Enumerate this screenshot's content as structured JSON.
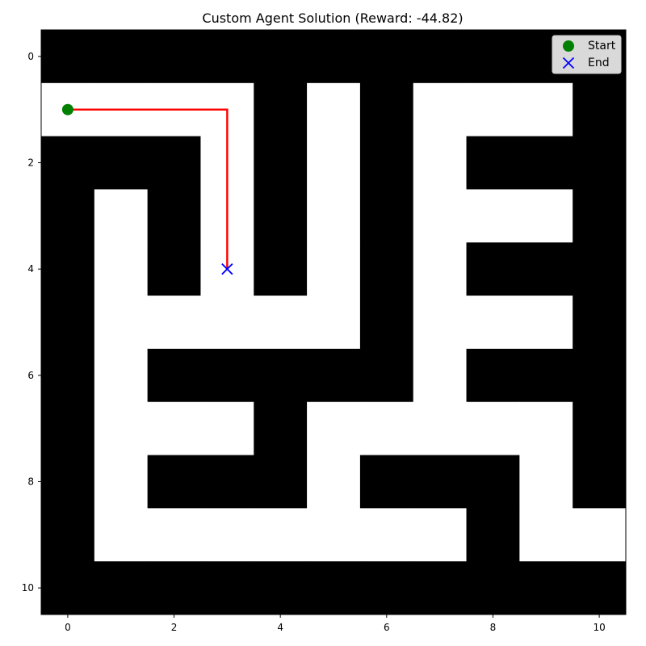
{
  "title": "Custom Agent Solution (Reward: -44.82)",
  "axes": {
    "x_ticks": [
      0,
      2,
      4,
      6,
      8,
      10
    ],
    "y_ticks": [
      0,
      2,
      4,
      6,
      8,
      10
    ],
    "x_range": [
      -0.5,
      10.5
    ],
    "y_range": [
      -0.5,
      10.5
    ],
    "y_inverted": true
  },
  "maze": {
    "wall_color": "#000000",
    "open_color": "#ffffff",
    "grid": [
      [
        1,
        1,
        1,
        1,
        1,
        1,
        1,
        1,
        1,
        1,
        1
      ],
      [
        0,
        0,
        0,
        0,
        1,
        0,
        1,
        0,
        0,
        0,
        1
      ],
      [
        1,
        1,
        1,
        0,
        1,
        0,
        1,
        0,
        1,
        1,
        1
      ],
      [
        1,
        0,
        1,
        0,
        1,
        0,
        1,
        0,
        0,
        0,
        1
      ],
      [
        1,
        0,
        1,
        0,
        1,
        0,
        1,
        0,
        1,
        1,
        1
      ],
      [
        1,
        0,
        0,
        0,
        0,
        0,
        1,
        0,
        0,
        0,
        1
      ],
      [
        1,
        0,
        1,
        1,
        1,
        1,
        1,
        0,
        1,
        1,
        1
      ],
      [
        1,
        0,
        0,
        0,
        1,
        0,
        0,
        0,
        0,
        0,
        1
      ],
      [
        1,
        0,
        1,
        1,
        1,
        0,
        1,
        1,
        1,
        0,
        1
      ],
      [
        1,
        0,
        0,
        0,
        0,
        0,
        0,
        0,
        1,
        0,
        0
      ],
      [
        1,
        1,
        1,
        1,
        1,
        1,
        1,
        1,
        1,
        1,
        1
      ]
    ]
  },
  "path": {
    "color": "#ff0000",
    "points": [
      [
        0,
        1
      ],
      [
        1,
        1
      ],
      [
        2,
        1
      ],
      [
        3,
        1
      ],
      [
        3,
        2
      ],
      [
        3,
        3
      ],
      [
        3,
        4
      ]
    ]
  },
  "start": {
    "x": 0,
    "y": 1,
    "color": "#008000"
  },
  "end": {
    "x": 3,
    "y": 4,
    "color": "#0000ff"
  },
  "legend": {
    "placement": "top-right",
    "start_label": "Start",
    "end_label": "End"
  }
}
